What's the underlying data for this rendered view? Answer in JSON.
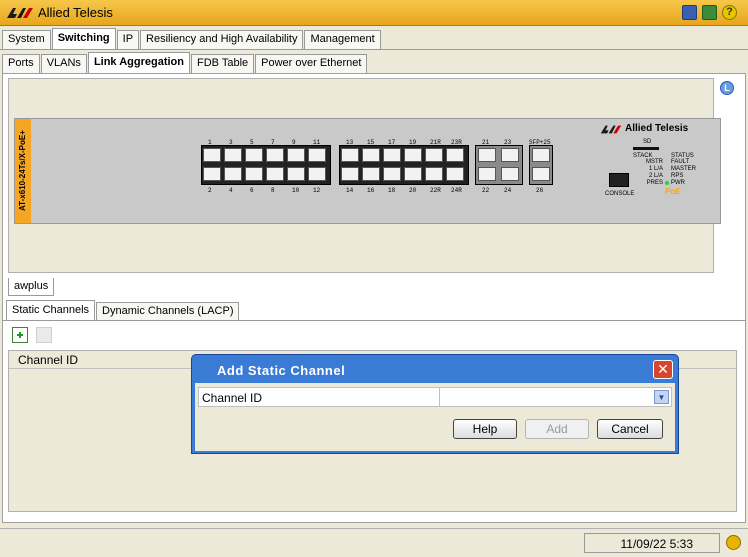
{
  "window": {
    "title": "Allied Telesis"
  },
  "main_tabs": [
    "System",
    "Switching",
    "IP",
    "Resiliency and High Availability",
    "Management"
  ],
  "sub_tabs": [
    "Ports",
    "VLANs",
    "Link Aggregation",
    "FDB Table",
    "Power over Ethernet"
  ],
  "device": {
    "model": "AT-x610-24Ts/X-PoE+",
    "brand": "Allied Telesis",
    "top_ports": [
      "1",
      "3",
      "5",
      "7",
      "9",
      "11",
      "13",
      "15",
      "17",
      "19",
      "21R",
      "23R"
    ],
    "bottom_ports": [
      "2",
      "4",
      "6",
      "8",
      "10",
      "12",
      "14",
      "16",
      "18",
      "20",
      "22R",
      "24R"
    ],
    "sfp_top": [
      "21",
      "23"
    ],
    "sfp_bottom": [
      "22",
      "24"
    ],
    "sfpplus_top": "SFP+25",
    "sfpplus_bottom": "26",
    "console": "CONSOLE",
    "sd": "SD",
    "stack": "STACK",
    "status": "STATUS",
    "leds_left": [
      "MSTR",
      "1 L/A",
      "2 L/A",
      "PRES"
    ],
    "leds_right": [
      "FAULT",
      "MASTER",
      "RPS",
      "PWR"
    ],
    "poe": "PoE"
  },
  "device_tab": "awplus",
  "channel_tabs": [
    "Static Channels",
    "Dynamic Channels (LACP)"
  ],
  "table": {
    "header": "Channel ID"
  },
  "dialog": {
    "title": "Add Static Channel",
    "field_label": "Channel ID",
    "field_value": "",
    "help": "Help",
    "add": "Add",
    "cancel": "Cancel"
  },
  "statusbar": {
    "datetime": "11/09/22 5:33"
  },
  "colors": {
    "accent": "#f0b431",
    "dialog_title": "#1f5fc1",
    "side_label": "#f5a623"
  }
}
